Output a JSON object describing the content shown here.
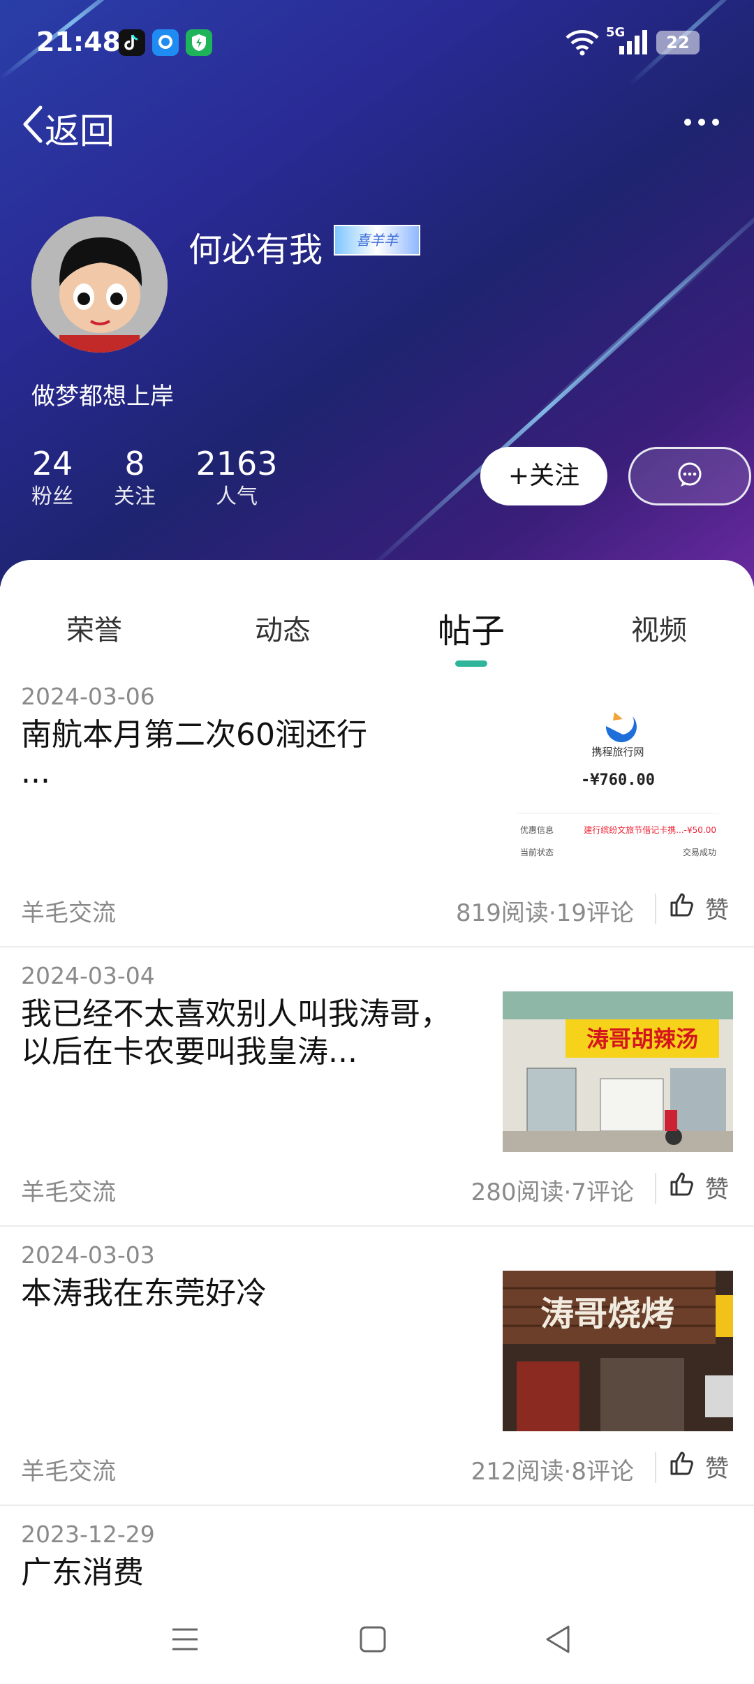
{
  "status_bar": {
    "time": "21:48",
    "network": "5G",
    "battery": "22"
  },
  "top_bar": {
    "back_label": "返回"
  },
  "profile": {
    "name": "何必有我",
    "badge_text": "喜羊羊",
    "bio": "做梦都想上岸",
    "stats": [
      {
        "value": "24",
        "label": "粉丝"
      },
      {
        "value": "8",
        "label": "关注"
      },
      {
        "value": "2163",
        "label": "人气"
      }
    ],
    "follow_label": "+关注"
  },
  "tabs": [
    {
      "label": "荣誉",
      "active": false
    },
    {
      "label": "动态",
      "active": false
    },
    {
      "label": "帖子",
      "active": true
    },
    {
      "label": "视频",
      "active": false
    }
  ],
  "posts": [
    {
      "date": "2024-03-06",
      "title": "南航本月第二次60润还行\n...",
      "category": "羊毛交流",
      "meta": "819阅读·19评论",
      "like_label": "赞",
      "thumbnail": {
        "kind": "receipt",
        "merchant": "携程旅行网",
        "amount": "-¥760.00",
        "row1_label": "优惠信息",
        "row1_value": "建行缤纷文旅节借记卡携...-¥50.00",
        "row2_label": "当前状态",
        "row2_value": "交易成功"
      }
    },
    {
      "date": "2024-03-04",
      "title": "我已经不太喜欢别人叫我涛哥，以后在卡农要叫我皇涛...",
      "category": "羊毛交流",
      "meta": "280阅读·7评论",
      "like_label": "赞",
      "thumbnail": {
        "kind": "photo",
        "sign_text": "涛哥胡辣汤"
      }
    },
    {
      "date": "2024-03-03",
      "title": "本涛我在东莞好冷",
      "category": "羊毛交流",
      "meta": "212阅读·8评论",
      "like_label": "赞",
      "thumbnail": {
        "kind": "photo",
        "sign_text": "涛哥烧烤"
      }
    },
    {
      "date": "2023-12-29",
      "title": "广东消费"
    }
  ],
  "colors": {
    "accent": "#2fb59a",
    "header_start": "#2a3ea8",
    "header_end": "#6a2aa0"
  }
}
